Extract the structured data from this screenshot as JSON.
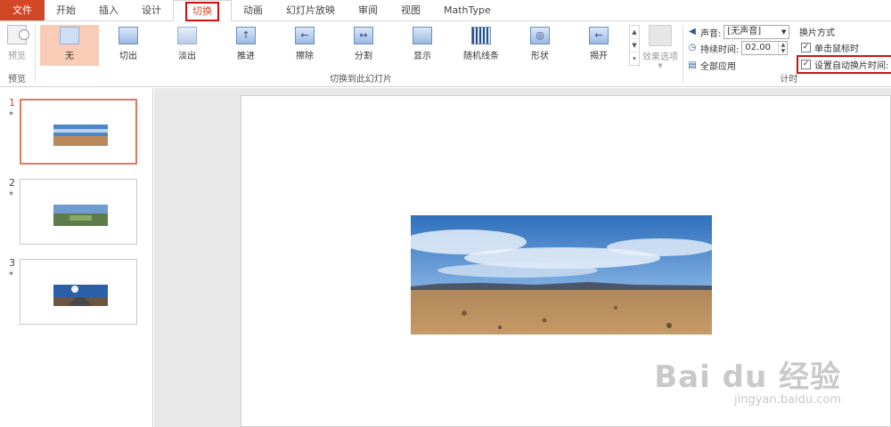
{
  "tabs": [
    {
      "label": "文件",
      "kind": "file"
    },
    {
      "label": "开始",
      "kind": "normal"
    },
    {
      "label": "插入",
      "kind": "normal"
    },
    {
      "label": "设计",
      "kind": "normal"
    },
    {
      "label": "切换",
      "kind": "active"
    },
    {
      "label": "动画",
      "kind": "normal"
    },
    {
      "label": "幻灯片放映",
      "kind": "normal"
    },
    {
      "label": "审阅",
      "kind": "normal"
    },
    {
      "label": "视图",
      "kind": "normal"
    },
    {
      "label": "MathType",
      "kind": "normal"
    }
  ],
  "ribbon": {
    "preview_label": "预览",
    "preview_group_label": "预览",
    "transitions_group_label": "切换到此幻灯片",
    "transitions": [
      {
        "label": "无",
        "icon": "none-transition-icon",
        "selected": true
      },
      {
        "label": "切出",
        "icon": "cut-transition-icon",
        "selected": false
      },
      {
        "label": "淡出",
        "icon": "fade-transition-icon",
        "selected": false
      },
      {
        "label": "推进",
        "icon": "push-transition-icon",
        "selected": false
      },
      {
        "label": "擦除",
        "icon": "wipe-transition-icon",
        "selected": false
      },
      {
        "label": "分割",
        "icon": "split-transition-icon",
        "selected": false
      },
      {
        "label": "显示",
        "icon": "reveal-transition-icon",
        "selected": false
      },
      {
        "label": "随机线条",
        "icon": "random-bars-transition-icon",
        "selected": false
      },
      {
        "label": "形状",
        "icon": "shape-transition-icon",
        "selected": false
      },
      {
        "label": "揭开",
        "icon": "uncover-transition-icon",
        "selected": false
      }
    ],
    "effect_options_label": "效果选项",
    "timing": {
      "sound_label": "声音:",
      "sound_value": "[无声音]",
      "duration_label": "持续时间:",
      "duration_value": "02.00",
      "apply_all_label": "全部应用",
      "advance_heading": "换片方式",
      "on_click_label": "单击鼠标时",
      "on_click_checked": true,
      "auto_after_label": "设置自动换片时间:",
      "auto_after_checked": true,
      "group_label": "计时"
    }
  },
  "slides": [
    {
      "number": "1",
      "star": "*",
      "selected": true
    },
    {
      "number": "2",
      "star": "*",
      "selected": false
    },
    {
      "number": "3",
      "star": "*",
      "selected": false
    }
  ],
  "watermark": {
    "brand": "Bai du 经验",
    "url": "jingyan.baidu.com"
  },
  "colors": {
    "accent": "#d24726",
    "highlight_box": "#d01010",
    "selected_transition": "#f9ccb8"
  }
}
